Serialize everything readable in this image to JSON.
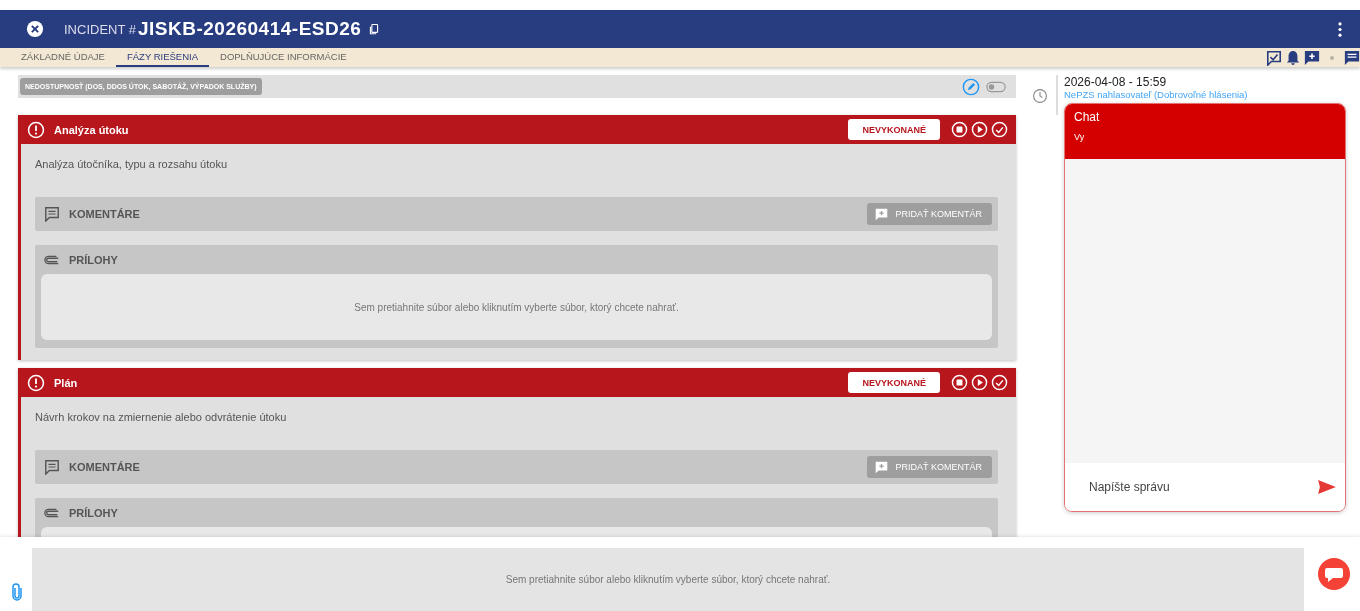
{
  "header": {
    "prefix": "INCIDENT #",
    "incident_id": "JISKB-20260414-ESD26"
  },
  "tabs": [
    {
      "label": "ZÁKLADNÉ ÚDAJE",
      "selected": false
    },
    {
      "label": "FÁZY RIEŠENIA",
      "selected": true
    },
    {
      "label": "DOPLŇUJÚCE INFORMÁCIE",
      "selected": false
    }
  ],
  "category": {
    "label": "NEDOSTUPNOSŤ (DOS, DDOS ÚTOK, SABOTÁŽ, VÝPADOK SLUŽBY)",
    "enabled": false
  },
  "phases": [
    {
      "title": "Analýza útoku",
      "status": "NEVYKONANÉ",
      "description": "Analýza útočníka, typu a rozsahu útoku",
      "comments_label": "KOMENTÁRE",
      "add_comment": "PRIDAŤ KOMENTÁR",
      "attachments_label": "PRÍLOHY",
      "dropzone": "Sem pretiahnite súbor alebo kliknutím vyberte súbor, ktorý chcete nahrať."
    },
    {
      "title": "Plán",
      "status": "NEVYKONANÉ",
      "description": "Návrh krokov na zmiernenie alebo odvrátenie útoku",
      "comments_label": "KOMENTÁRE",
      "add_comment": "PRIDAŤ KOMENTÁR",
      "attachments_label": "PRÍLOHY"
    }
  ],
  "timeline": {
    "datetime": "2026-04-08 - 15:59",
    "reporter": "NePZS nahlasovateľ (Dobrovoľné hlásenia)"
  },
  "chat": {
    "title": "Chat",
    "subtitle": "Vy",
    "placeholder": "Napíšte správu"
  },
  "bottom": {
    "dropzone": "Sem pretiahnite súbor alebo kliknutím vyberte súbor, ktorý chcete nahrať."
  }
}
